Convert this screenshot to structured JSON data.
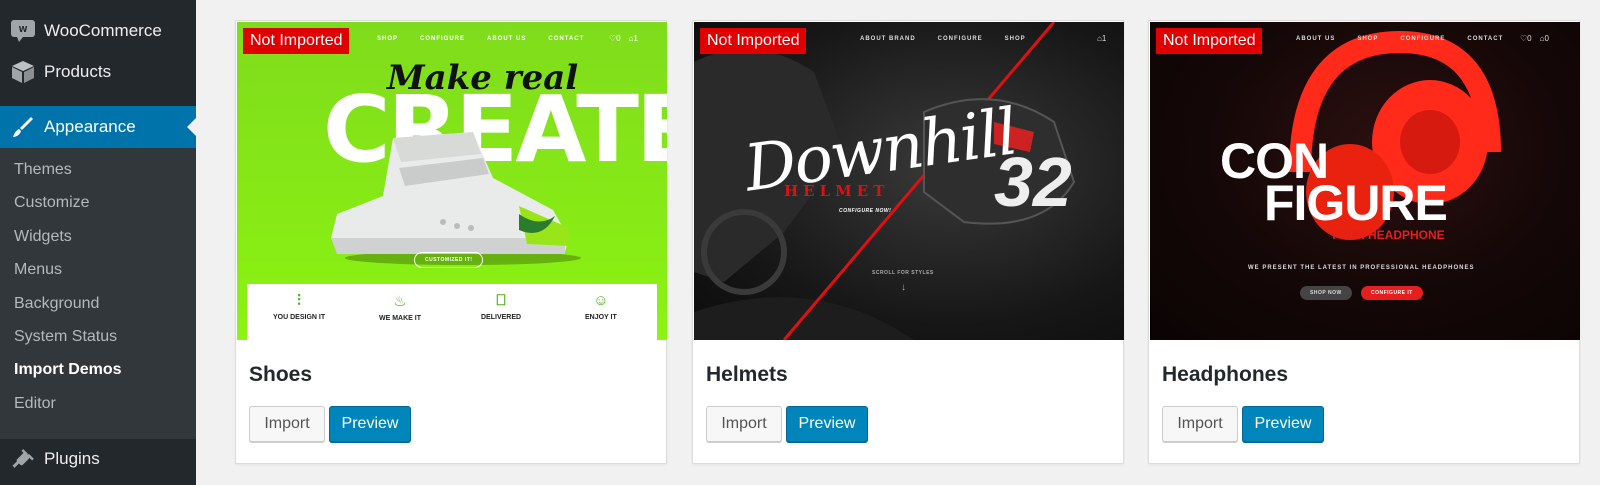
{
  "sidebar": {
    "menu": [
      {
        "label": "WooCommerce",
        "icon": "woocommerce-icon"
      },
      {
        "label": "Products",
        "icon": "cube-icon"
      },
      {
        "label": "Appearance",
        "icon": "paintbrush-icon",
        "active": true
      },
      {
        "label": "Plugins",
        "icon": "plug-icon"
      }
    ],
    "submenu": [
      "Themes",
      "Customize",
      "Widgets",
      "Menus",
      "Background",
      "System Status",
      "Import Demos",
      "Editor"
    ],
    "current_submenu": "Import Demos"
  },
  "demos": [
    {
      "title": "Shoes",
      "status": "Not Imported",
      "import_label": "Import",
      "preview_label": "Preview",
      "screenshot": {
        "nav": [
          "SHOP",
          "CONFIGURE",
          "ABOUT US",
          "CONTACT"
        ],
        "wishlist_count": "0",
        "cart_count": "1",
        "headline_script": "Make real",
        "headline": "CREATE",
        "cta": "CUSTOMIZED IT!",
        "features": [
          "YOU DESIGN IT",
          "WE MAKE IT",
          "DELIVERED",
          "ENJOY IT"
        ]
      }
    },
    {
      "title": "Helmets",
      "status": "Not Imported",
      "import_label": "Import",
      "preview_label": "Preview",
      "screenshot": {
        "nav": [
          "ABOUT BRAND",
          "CONFIGURE",
          "SHOP"
        ],
        "cart_count": "1",
        "headline_script": "Downhill",
        "headline_sub": "HELMET",
        "cta": "CONFIGURE NOW!",
        "number": "32",
        "scroll_text": "SCROLL FOR STYLES"
      }
    },
    {
      "title": "Headphones",
      "status": "Not Imported",
      "import_label": "Import",
      "preview_label": "Preview",
      "screenshot": {
        "nav": [
          "ABOUT US",
          "SHOP",
          "CONFIGURE",
          "CONTACT"
        ],
        "wishlist_count": "0",
        "cart_count": "0",
        "headline_1": "CON",
        "headline_2": "FIGURE",
        "headline_sub": "YOUR HEADPHONE",
        "tagline": "WE PRESENT THE LATEST IN PROFESSIONAL HEADPHONES",
        "cta_primary": "SHOP NOW",
        "cta_secondary": "CONFIGURE IT"
      }
    }
  ],
  "colors": {
    "sidebar_bg": "#23282d",
    "submenu_bg": "#32373c",
    "active": "#0073aa",
    "badge": "#e00000",
    "preview_button": "#0085ba"
  }
}
